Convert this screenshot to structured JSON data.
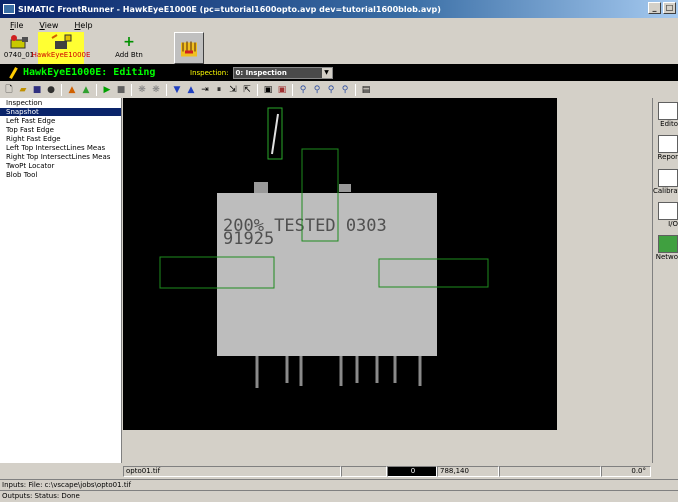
{
  "window": {
    "title": "SIMATIC FrontRunner - HawkEyeE1000E (pc=tutorial1600opto.avp dev=tutorial1600blob.avp)",
    "controls": [
      "_",
      "□"
    ]
  },
  "menu": [
    "File",
    "View",
    "Help"
  ],
  "devices": [
    {
      "label": "0740_01",
      "icon": "camera-plug-icon"
    },
    {
      "label": "HawkEyeE1000E",
      "icon": "camera-lock-icon"
    },
    {
      "label": "Add Btn",
      "icon": "plus-icon"
    },
    {
      "label": "",
      "icon": "hands-icon"
    }
  ],
  "editor": {
    "title": "HawkEyeE1000E: Editing",
    "inspection_label": "Inspection:",
    "inspection_value": "0: Inspection"
  },
  "tree": {
    "items": [
      "Inspection",
      "Snapshot",
      "Left Fast Edge",
      "Top Fast Edge",
      "Right Fast Edge",
      "Left Top IntersectLines Meas",
      "Right Top IntersectLines Meas",
      "TwoPt Locator",
      "Blob Tool"
    ],
    "selected": "Snapshot"
  },
  "image": {
    "part_text_line1": "200% TESTED 0303",
    "part_text_line2": "91925"
  },
  "status": {
    "file": "opto01.tif",
    "value": "0",
    "coords": "788,140",
    "angle": "0.0°"
  },
  "right_panel": [
    "Edito",
    "Repor",
    "Calibrati",
    "I/O",
    "Netwo"
  ],
  "footer": {
    "inputs": "Inputs: File: c:\\vscape\\jobs\\opto01.tif",
    "outputs": "Outputs: Status: Done"
  },
  "colors": {
    "editbar_bg": "#000000",
    "editbar_text": "#00ff00",
    "roi": "#1e8c1e",
    "selection": "#0a246a"
  }
}
